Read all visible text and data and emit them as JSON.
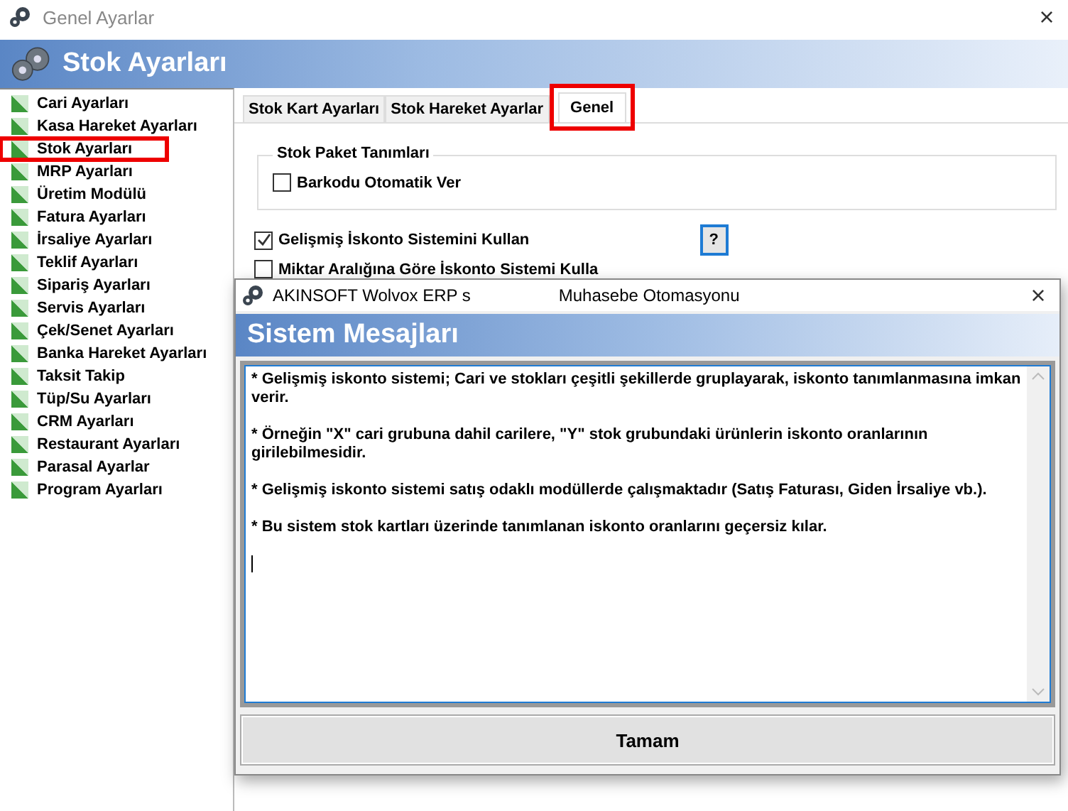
{
  "window": {
    "title": "Genel Ayarlar",
    "close": "×"
  },
  "header": {
    "title": "Stok Ayarları"
  },
  "sidebar": {
    "items": [
      {
        "label": "Cari Ayarları",
        "highlighted": false
      },
      {
        "label": "Kasa Hareket Ayarları",
        "highlighted": false
      },
      {
        "label": "Stok Ayarları",
        "highlighted": true
      },
      {
        "label": "MRP Ayarları",
        "highlighted": false
      },
      {
        "label": "Üretim Modülü",
        "highlighted": false
      },
      {
        "label": "Fatura Ayarları",
        "highlighted": false
      },
      {
        "label": "İrsaliye Ayarları",
        "highlighted": false
      },
      {
        "label": "Teklif Ayarları",
        "highlighted": false
      },
      {
        "label": "Sipariş Ayarları",
        "highlighted": false
      },
      {
        "label": "Servis Ayarları",
        "highlighted": false
      },
      {
        "label": "Çek/Senet Ayarları",
        "highlighted": false
      },
      {
        "label": "Banka Hareket Ayarları",
        "highlighted": false
      },
      {
        "label": "Taksit Takip",
        "highlighted": false
      },
      {
        "label": "Tüp/Su Ayarları",
        "highlighted": false
      },
      {
        "label": "CRM Ayarları",
        "highlighted": false
      },
      {
        "label": "Restaurant Ayarları",
        "highlighted": false
      },
      {
        "label": "Parasal Ayarlar",
        "highlighted": false
      },
      {
        "label": "Program Ayarları",
        "highlighted": false
      }
    ]
  },
  "tabs": [
    {
      "label": "Stok Kart Ayarları",
      "selected": false,
      "highlighted": false
    },
    {
      "label": "Stok Hareket Ayarlar",
      "selected": false,
      "highlighted": false
    },
    {
      "label": "Genel",
      "selected": true,
      "highlighted": true
    }
  ],
  "group": {
    "title": "Stok Paket Tanımları",
    "checkboxes": [
      {
        "label": "Barkodu Otomatik Ver",
        "checked": false
      }
    ]
  },
  "options": [
    {
      "label": "Gelişmiş İskonto Sistemini Kullan",
      "checked": true,
      "help": "?"
    },
    {
      "label": "Miktar Aralığına Göre İskonto Sistemi Kulla",
      "checked": false
    }
  ],
  "dialog": {
    "title": "AKINSOFT Wolvox ERP s",
    "subtitle": "Muhasebe Otomasyonu",
    "close": "×",
    "header": "Sistem Mesajları",
    "paragraphs": [
      "* Gelişmiş iskonto sistemi; Cari ve stokları çeşitli şekillerde gruplayarak, iskonto tanımlanmasına imkan verir.",
      "* Örneğin \"X\" cari grubuna dahil carilere, \"Y\" stok grubundaki ürünlerin iskonto oranlarının girilebilmesidir.",
      "* Gelişmiş iskonto sistemi satış odaklı modüllerde çalışmaktadır (Satış Faturası, Giden İrsaliye vb.).",
      "* Bu sistem stok kartları üzerinde tanımlanan iskonto oranlarını geçersiz kılar."
    ],
    "button": "Tamam"
  }
}
